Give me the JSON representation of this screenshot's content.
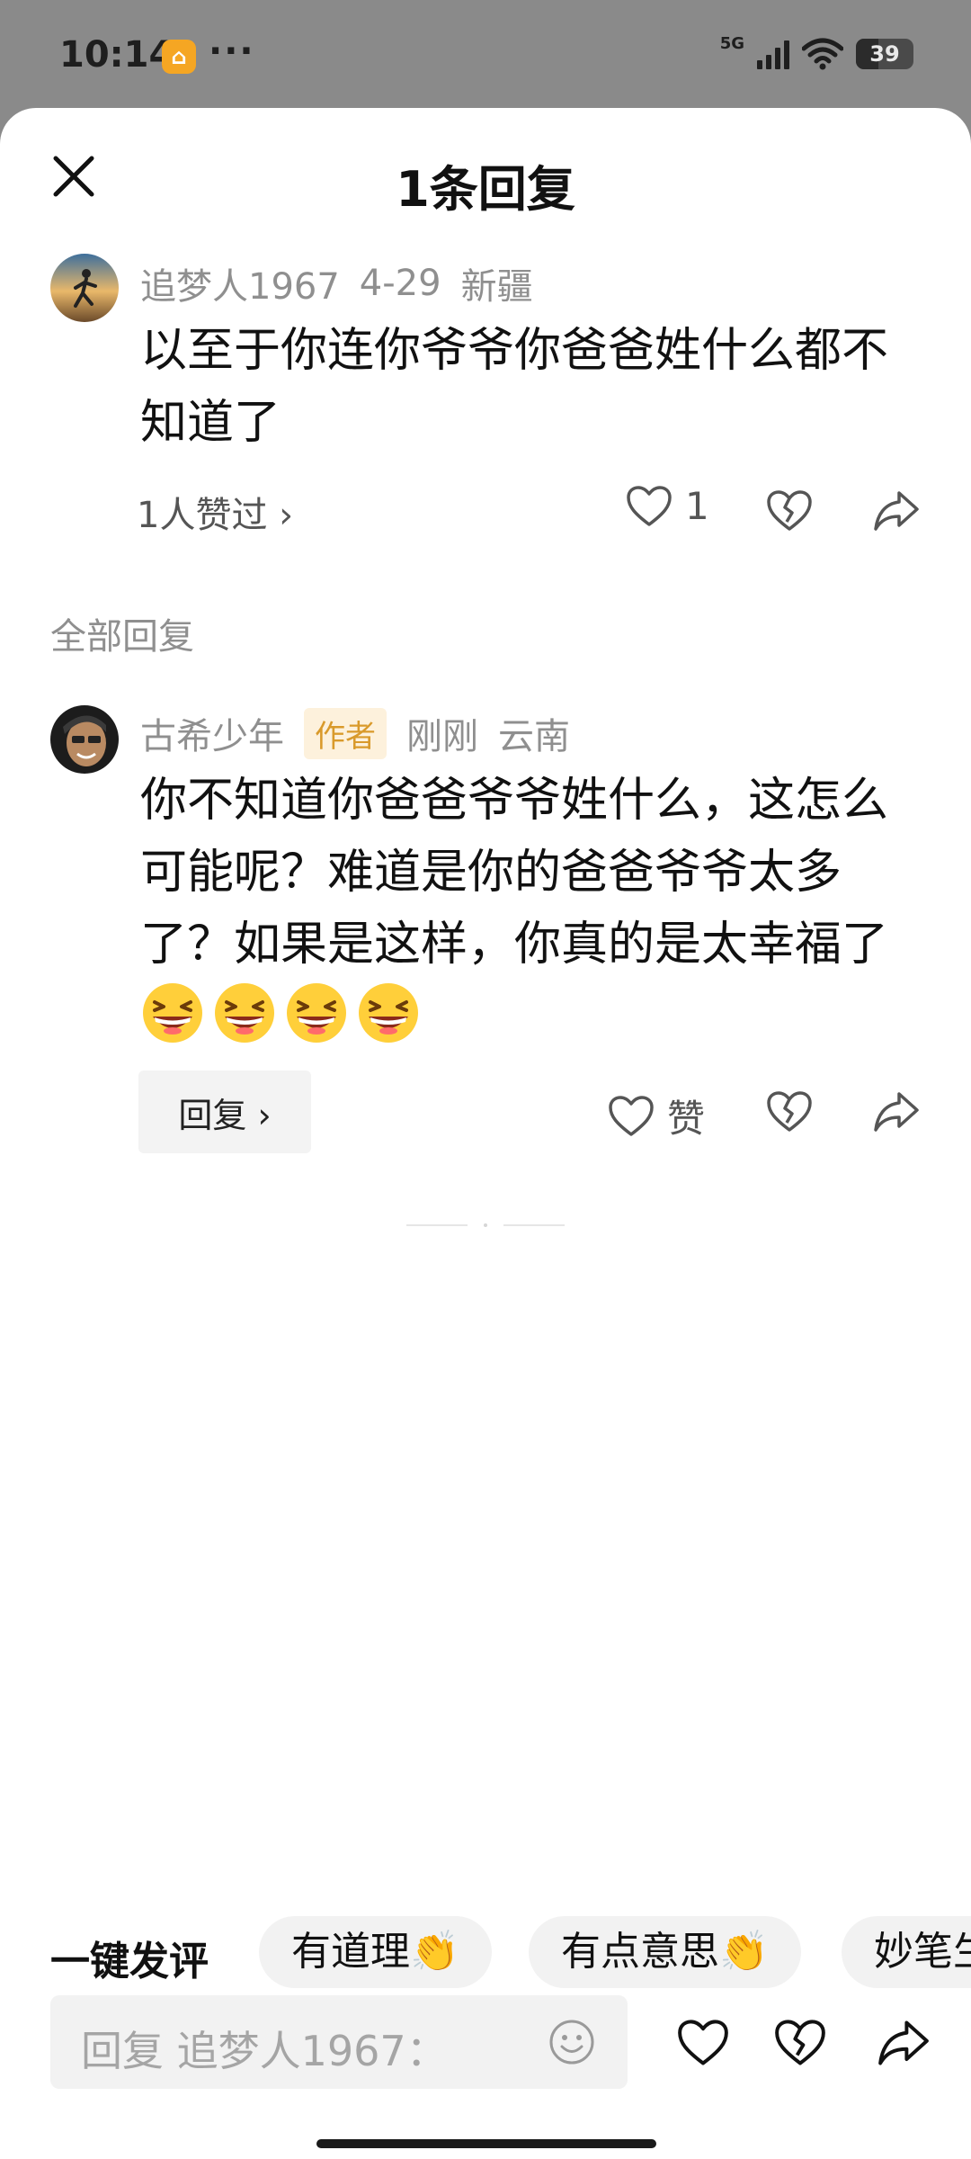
{
  "status": {
    "time": "10:14",
    "dots": "···",
    "network": "5G",
    "battery": "39",
    "battery_level": 0.39
  },
  "header": {
    "title": "1条回复"
  },
  "original_comment": {
    "username": "追梦人1967",
    "date": "4-29",
    "location": "新疆",
    "text": "以至于你连你爷爷你爸爸姓什么都不知道了",
    "likes_summary": "1人赞过 ›",
    "like_count": "1"
  },
  "section_label": "全部回复",
  "reply": {
    "username": "古希少年",
    "badge": "作者",
    "time": "刚刚",
    "location": "云南",
    "text": "你不知道你爸爸爷爷姓什么，这怎么可能呢？难道是你的爸爸爷爷太多了？如果是这样，你真的是太幸福了",
    "emoji_count": 4,
    "emoji_name": "grinning-squint-face-emoji",
    "like_label": "赞",
    "reply_button": "回复 ›"
  },
  "quick_comment": {
    "label": "一键发评",
    "chips": [
      "有道理👏",
      "有点意思👏",
      "妙笔生"
    ]
  },
  "input": {
    "placeholder": "回复 追梦人1967："
  },
  "colors": {
    "status_bg": "#8a8a8a",
    "sheet_bg": "#ffffff",
    "meta_gray": "#8f8f8f",
    "author_badge_bg": "#fdf1dc",
    "author_badge_text": "#d99a2b"
  }
}
